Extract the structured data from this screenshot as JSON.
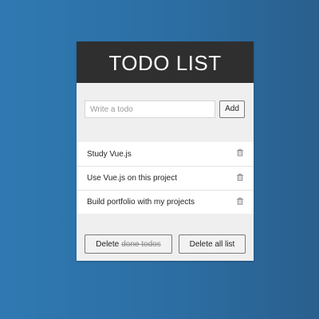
{
  "app": {
    "title": "TODO LIST"
  },
  "add_form": {
    "placeholder": "Write a todo",
    "value": "",
    "button_label": "Add"
  },
  "todos": [
    {
      "text": "Study Vue.js",
      "delete_icon": "trash-icon"
    },
    {
      "text": "Use Vue.js on this project",
      "delete_icon": "trash-icon"
    },
    {
      "text": "Build portfolio with my projects",
      "delete_icon": "trash-icon"
    }
  ],
  "footer": {
    "delete_prefix": "Delete",
    "delete_done_strike": "done todos",
    "delete_all_label": "Delete all list"
  },
  "colors": {
    "header_bg": "#2f2f2f",
    "card_bg": "#efefef",
    "page_gradient_start": "#2f79b2",
    "page_gradient_end": "#2a5f8d"
  }
}
